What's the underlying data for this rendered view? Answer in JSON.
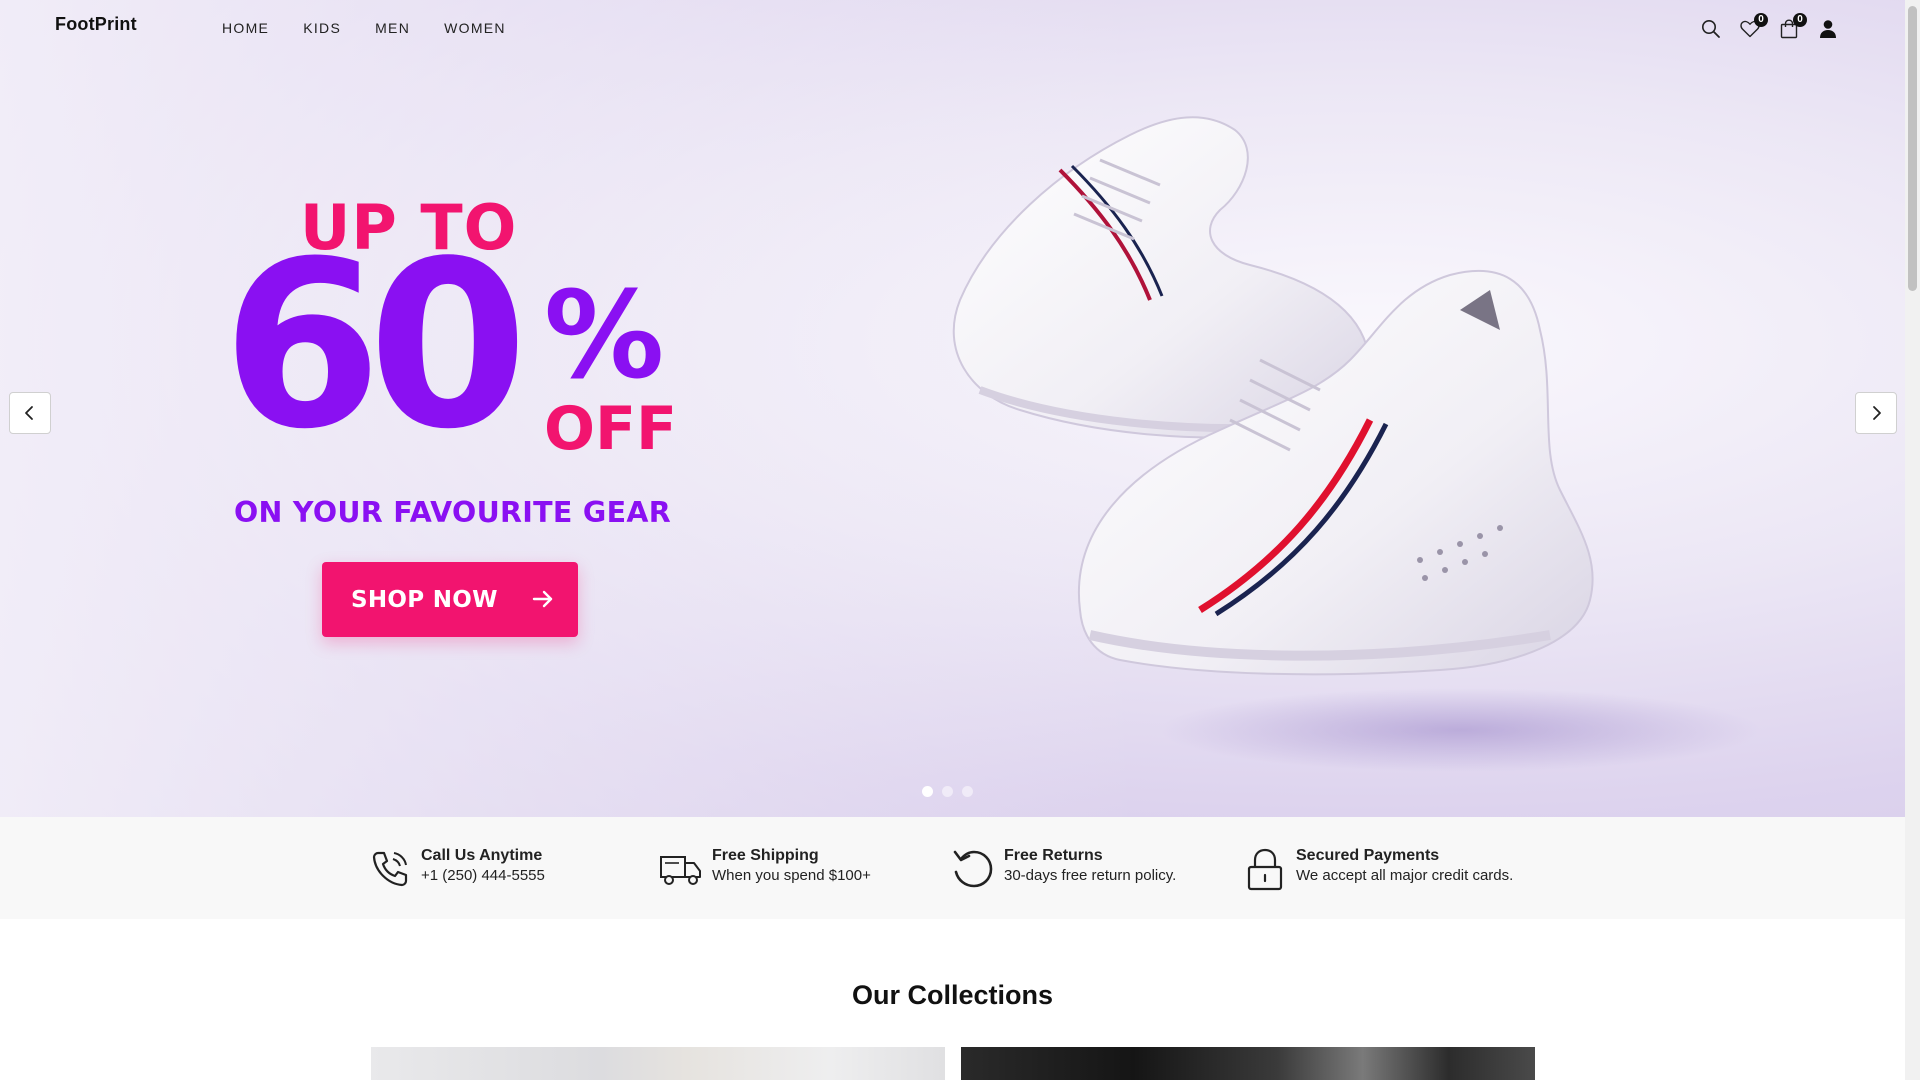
{
  "header": {
    "logo": "FootPrint",
    "nav": [
      {
        "label": "HOME"
      },
      {
        "label": "KIDS"
      },
      {
        "label": "MEN"
      },
      {
        "label": "WOMEN"
      }
    ],
    "wishlist_count": "0",
    "cart_count": "0",
    "icons": [
      "search-icon",
      "heart-icon",
      "bag-icon",
      "user-icon"
    ]
  },
  "hero": {
    "line1": "UP TO",
    "number": "60",
    "percent": "%",
    "off": "OFF",
    "tagline": "ON YOUR FAVOURITE GEAR",
    "cta": "SHOP NOW",
    "slides": 3,
    "active_slide": 1,
    "colors": {
      "pink": "#f2146f",
      "purple": "#8a10f2"
    }
  },
  "features": [
    {
      "title": "Call Us Anytime",
      "subtitle": "+1 (250) 444-5555",
      "icon": "phone-icon"
    },
    {
      "title": "Free Shipping",
      "subtitle": "When you spend $100+",
      "icon": "truck-icon"
    },
    {
      "title": "Free Returns",
      "subtitle": "30-days free return policy.",
      "icon": "return-icon"
    },
    {
      "title": "Secured Payments",
      "subtitle": "We accept all major credit cards.",
      "icon": "lock-icon"
    }
  ],
  "collections": {
    "title": "Our Collections"
  }
}
